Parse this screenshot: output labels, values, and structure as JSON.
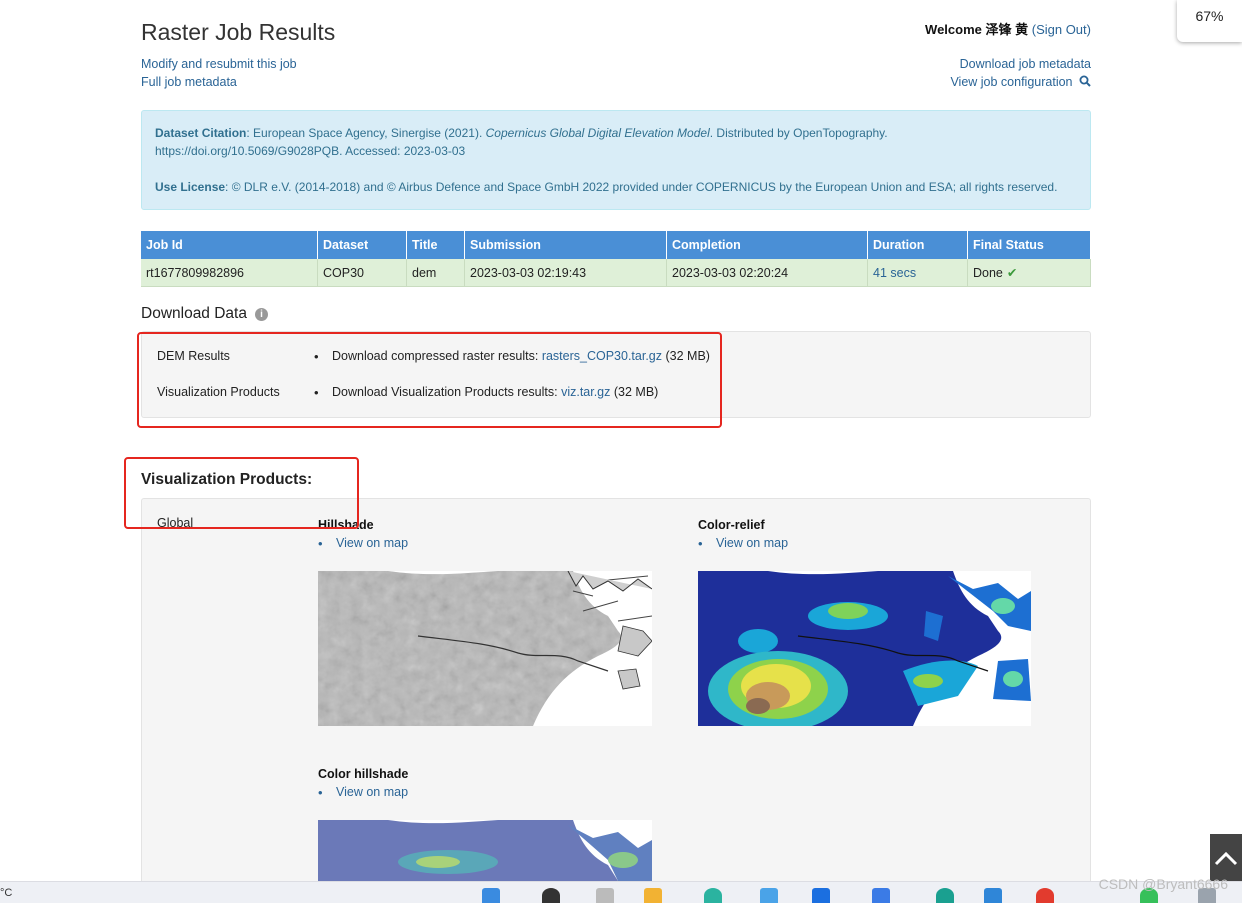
{
  "browser": {
    "zoom_label": "67%"
  },
  "header": {
    "title": "Raster Job Results",
    "welcome_prefix": "Welcome 泽锋 黄",
    "sign_out_open": "(",
    "sign_out": "Sign Out",
    "sign_out_close": ")",
    "links_left": [
      "Modify and resubmit this job",
      "Full job metadata"
    ],
    "links_right": [
      "Download job metadata",
      "View job configuration"
    ]
  },
  "citation": {
    "label1": "Dataset Citation",
    "text1a": ": European Space Agency, Sinergise (2021). ",
    "text1_italic": "Copernicus Global Digital Elevation Model",
    "text1b": ". Distributed by OpenTopography.",
    "text1c": "https://doi.org/10.5069/G9028PQB. Accessed: 2023-03-03",
    "label2": "Use License",
    "text2": ": © DLR e.V. (2014-2018) and © Airbus Defence and Space GmbH 2022 provided under COPERNICUS by the European Union and ESA; all rights reserved."
  },
  "job_table": {
    "headers": [
      "Job Id",
      "Dataset",
      "Title",
      "Submission",
      "Completion",
      "Duration",
      "Final Status"
    ],
    "row": {
      "job_id": "rt1677809982896",
      "dataset": "COP30",
      "title": "dem",
      "submission": "2023-03-03 02:19:43",
      "completion": "2023-03-03 02:20:24",
      "duration": "41 secs",
      "status": "Done"
    }
  },
  "download": {
    "heading": "Download Data",
    "rows": [
      {
        "label": "DEM Results",
        "text": "Download compressed raster results: ",
        "link": "rasters_COP30.tar.gz",
        "size": " (32 MB)"
      },
      {
        "label": "Visualization Products",
        "text": "Download Visualization Products results: ",
        "link": "viz.tar.gz",
        "size": " (32 MB)"
      }
    ]
  },
  "viz": {
    "heading": "Visualization Products:",
    "group_label": "Global",
    "items": [
      {
        "title": "Hillshade",
        "link": "View on map"
      },
      {
        "title": "Color-relief",
        "link": "View on map"
      },
      {
        "title": "Color hillshade",
        "link": "View on map"
      }
    ]
  },
  "taskbar": {
    "temp": "°C",
    "watermark": "CSDN @Bryant6666"
  },
  "colors": {
    "accent": "#4a8fd6",
    "link": "#2a6496",
    "annotation_red": "#e5261f",
    "success_bg": "#dff0d8",
    "info_bg": "#d9edf7"
  }
}
